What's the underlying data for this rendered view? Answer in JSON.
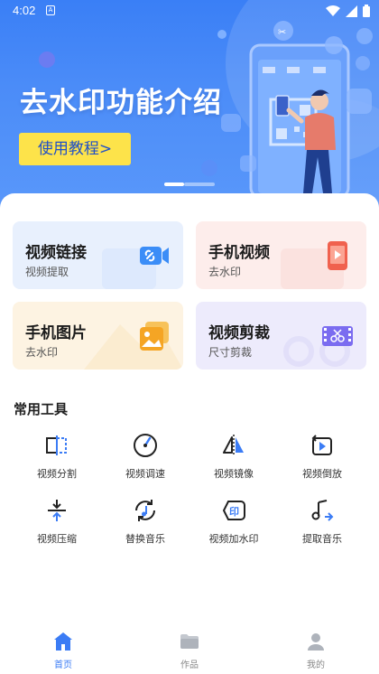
{
  "status_bar": {
    "time": "4:02",
    "a_icon": "A"
  },
  "banner": {
    "title": "去水印功能介绍",
    "button_label": "使用教程>"
  },
  "feature_cards": [
    {
      "title": "视频链接",
      "subtitle": "视频提取",
      "icon": "link-video-icon"
    },
    {
      "title": "手机视频",
      "subtitle": "去水印",
      "icon": "phone-video-icon"
    },
    {
      "title": "手机图片",
      "subtitle": "去水印",
      "icon": "image-icon"
    },
    {
      "title": "视频剪裁",
      "subtitle": "尺寸剪裁",
      "icon": "film-scissors-icon"
    }
  ],
  "tools_section": {
    "title": "常用工具",
    "tools": [
      {
        "label": "视频分割",
        "icon": "split-icon"
      },
      {
        "label": "视频调速",
        "icon": "speed-gauge-icon"
      },
      {
        "label": "视频镜像",
        "icon": "mirror-icon"
      },
      {
        "label": "视频倒放",
        "icon": "reverse-play-icon"
      },
      {
        "label": "视频压缩",
        "icon": "compress-icon"
      },
      {
        "label": "替换音乐",
        "icon": "replace-music-icon"
      },
      {
        "label": "视频加水印",
        "icon": "add-watermark-icon"
      },
      {
        "label": "提取音乐",
        "icon": "extract-music-icon"
      }
    ]
  },
  "bottom_nav": [
    {
      "label": "首页",
      "icon": "home-icon",
      "active": true
    },
    {
      "label": "作品",
      "icon": "folder-icon",
      "active": false
    },
    {
      "label": "我的",
      "icon": "user-icon",
      "active": false
    }
  ],
  "colors": {
    "accent": "#3b7cf5",
    "banner_button": "#fde34a",
    "card_blue": "#e9f1fd",
    "card_red": "#fdeeec",
    "card_yellow": "#fdf4e3",
    "card_purple": "#eeecfc"
  }
}
